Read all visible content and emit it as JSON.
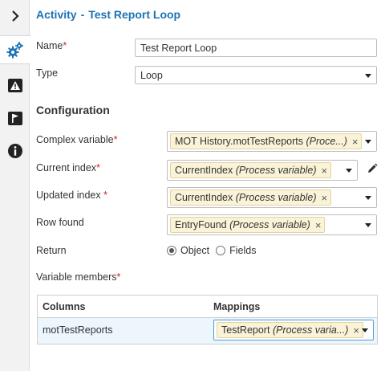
{
  "rail": {
    "items": [
      {
        "icon": "chevron-right-icon"
      },
      {
        "icon": "gears-icon"
      },
      {
        "icon": "warning-icon"
      },
      {
        "icon": "flag-board-icon"
      },
      {
        "icon": "info-icon"
      }
    ]
  },
  "header": {
    "prefix": "Activity",
    "separator": "-",
    "name": "Test Report Loop"
  },
  "form": {
    "name_label": "Name",
    "name_value": "Test Report Loop",
    "type_label": "Type",
    "type_value": "Loop",
    "config_heading": "Configuration",
    "complex_label": "Complex variable",
    "complex_chip_main": "MOT History.motTestReports",
    "complex_chip_type": "(Proce...)",
    "current_label": "Current index",
    "current_chip_main": "CurrentIndex",
    "current_chip_type": "(Process variable)",
    "updated_label": "Updated index",
    "updated_chip_main": "CurrentIndex",
    "updated_chip_type": "(Process variable)",
    "rowfound_label": "Row found",
    "rowfound_chip_main": "EntryFound",
    "rowfound_chip_type": "(Process variable)",
    "return_label": "Return",
    "return_opt_object": "Object",
    "return_opt_fields": "Fields",
    "return_selected": "Object",
    "members_label": "Variable members",
    "required_mark": "*",
    "remove_mark": "×"
  },
  "grid": {
    "col_columns": "Columns",
    "col_mappings": "Mappings",
    "rows": [
      {
        "column": "motTestReports",
        "mapping_main": "TestReport",
        "mapping_type": "(Process varia...)"
      }
    ]
  },
  "colors": {
    "title_blue": "#1a73b5",
    "required_red": "#d21f1f",
    "chip_bg": "#fbf3d8",
    "row_highlight": "#ecf6fc"
  }
}
